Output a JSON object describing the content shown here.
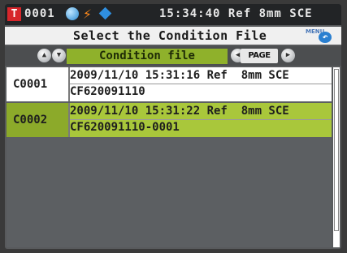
{
  "status": {
    "badge": "T",
    "number": "0001",
    "time_info": "15:34:40 Ref  8mm  SCE"
  },
  "title": {
    "text": "Select the Condition File",
    "menu_label": "MENU",
    "back_arrow": "↶"
  },
  "nav": {
    "label": "Condition file",
    "page_label": "PAGE"
  },
  "rows": [
    {
      "id": "C0001",
      "line1": "2009/11/10 15:31:16 Ref  8mm SCE",
      "line2": "CF620091110",
      "selected": false
    },
    {
      "id": "C0002",
      "line1": "2009/11/10 15:31:22 Ref  8mm SCE",
      "line2": "CF620091110-0001",
      "selected": true
    }
  ],
  "colors": {
    "accent_green": "#8fb12b",
    "selected_row": "#a9c73b",
    "badge_red": "#d7262b"
  }
}
